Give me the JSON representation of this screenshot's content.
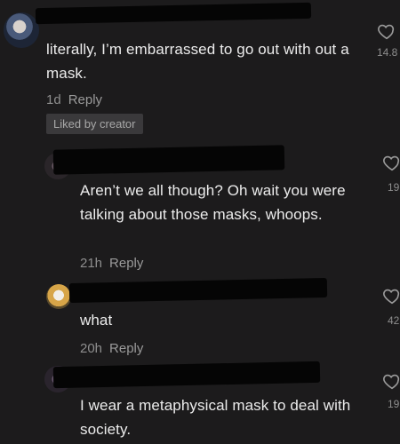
{
  "comments": [
    {
      "text": "literally, I’m embarrassed to go out with out a mask.",
      "time": "1d",
      "reply_label": "Reply",
      "badge": "Liked by creator",
      "likes": "14.8"
    },
    {
      "text": "Aren’t we all though? Oh wait you were talking about those masks, whoops.",
      "time": "21h",
      "reply_label": "Reply",
      "likes": "19"
    },
    {
      "text": "what",
      "time": "20h",
      "reply_label": "Reply",
      "likes": "42"
    },
    {
      "text": "I wear a metaphysical mask to deal with society.",
      "likes": "19"
    }
  ],
  "colors": {
    "background": "#1c1b1c",
    "text": "#ececec",
    "meta": "#8e8e8e",
    "badge_bg": "#3a393b",
    "redaction": "#050505"
  },
  "icons": {
    "like": "heart-outline-icon"
  }
}
